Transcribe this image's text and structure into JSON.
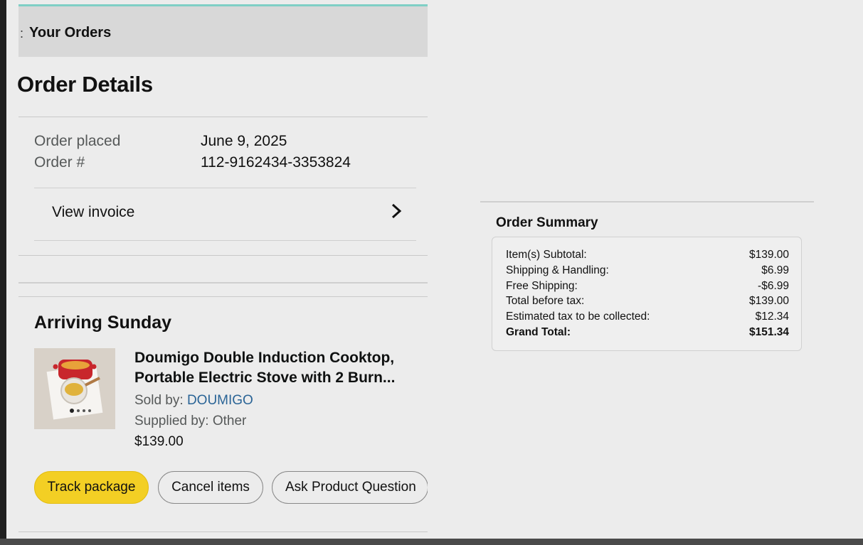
{
  "header": {
    "back_glyph": ":",
    "title": "Your Orders"
  },
  "page_title": "Order Details",
  "order_info": {
    "placed_label": "Order placed",
    "placed_value": "June 9, 2025",
    "number_label": "Order #",
    "number_value": "112-9162434-3353824",
    "invoice_label": "View invoice"
  },
  "delivery": {
    "status": "Arriving Sunday",
    "product": {
      "title": "Doumigo Double Induction Cooktop, Portable Electric Stove with 2 Burn...",
      "sold_by_label": "Sold by: ",
      "sold_by_value": "DOUMIGO",
      "supplied_by": "Supplied by: Other",
      "price": "$139.00"
    },
    "buttons": {
      "track": "Track package",
      "cancel": "Cancel items",
      "ask": "Ask Product Question"
    }
  },
  "summary": {
    "title": "Order Summary",
    "rows": [
      {
        "label": "Item(s) Subtotal:",
        "value": "$139.00"
      },
      {
        "label": "Shipping & Handling:",
        "value": "$6.99"
      },
      {
        "label": "Free Shipping:",
        "value": "-$6.99"
      },
      {
        "label": "Total before tax:",
        "value": "$139.00"
      },
      {
        "label": "Estimated tax to be collected:",
        "value": "$12.34"
      },
      {
        "label": "Grand Total:",
        "value": "$151.34"
      }
    ]
  },
  "colors": {
    "accent_header_line": "#7fcfc5",
    "primary_button": "#f3cf24",
    "link": "#2a6496"
  },
  "icons": [
    "chevron-right-icon",
    "product-thumbnail"
  ]
}
